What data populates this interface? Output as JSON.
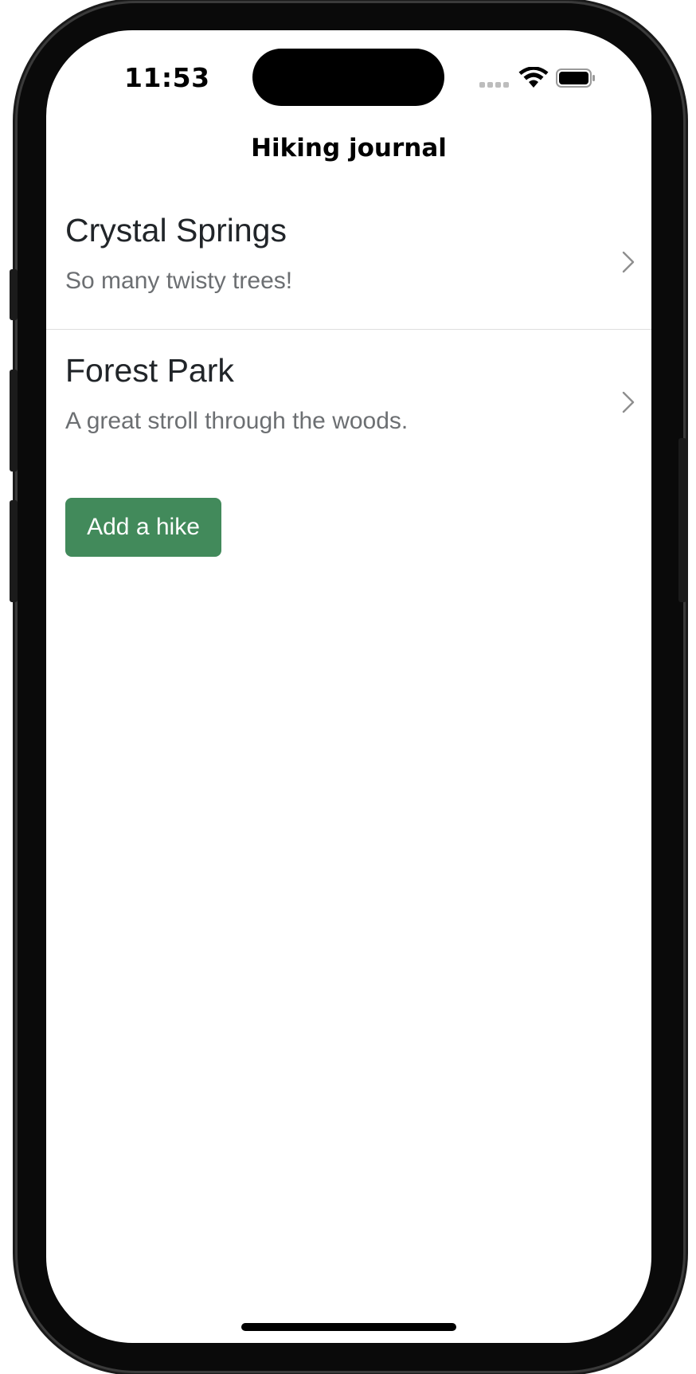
{
  "status_bar": {
    "time": "11:53"
  },
  "nav": {
    "title": "Hiking journal"
  },
  "hikes": [
    {
      "title": "Crystal Springs",
      "description": "So many twisty trees!"
    },
    {
      "title": "Forest Park",
      "description": "A great stroll through the woods."
    }
  ],
  "actions": {
    "add_label": "Add a hike"
  },
  "colors": {
    "accent": "#428a5b",
    "text_primary": "#212529",
    "text_secondary": "#6c6f72",
    "divider": "#dedede"
  },
  "icons": {
    "row_disclosure": "chevron-right-icon",
    "status_wifi": "wifi-icon",
    "status_battery": "battery-icon",
    "status_signal": "signal-icon"
  }
}
